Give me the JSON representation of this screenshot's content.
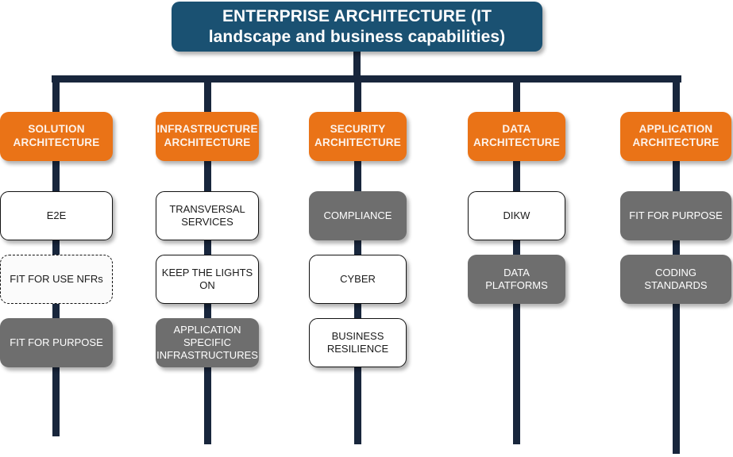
{
  "title": {
    "text": "ENTERPRISE ARCHITECTURE (IT landscape and business capabilities)",
    "color": "#1a5172",
    "text_color": "#ffffff"
  },
  "palette": {
    "orange": "#ea7317",
    "gray": "#6e6e6e",
    "navy_connector": "#18263c",
    "white": "#ffffff",
    "background": "#ffffff"
  },
  "pillars": [
    {
      "id": "solution-architecture",
      "header": "SOLUTION ARCHITECTURE",
      "nodes": [
        {
          "label": "E2E",
          "style": "white"
        },
        {
          "label": "FIT FOR USE NFRs",
          "style": "dashed"
        },
        {
          "label": "FIT FOR PURPOSE",
          "style": "gray"
        }
      ]
    },
    {
      "id": "infrastructure-architecture",
      "header": "INFRASTRUCTURE ARCHITECTURE",
      "nodes": [
        {
          "label": "TRANSVERSAL SERVICES",
          "style": "white"
        },
        {
          "label": "KEEP THE LIGHTS ON",
          "style": "white"
        },
        {
          "label": "APPLICATION SPECIFIC INFRASTRUCTURES",
          "style": "gray"
        }
      ]
    },
    {
      "id": "security-architecture",
      "header": "SECURITY ARCHITECTURE",
      "nodes": [
        {
          "label": "COMPLIANCE",
          "style": "gray"
        },
        {
          "label": "CYBER",
          "style": "white"
        },
        {
          "label": "BUSINESS RESILIENCE",
          "style": "white"
        }
      ]
    },
    {
      "id": "data-architecture",
      "header": "DATA ARCHITECTURE",
      "nodes": [
        {
          "label": "DIKW",
          "style": "white"
        },
        {
          "label": "DATA PLATFORMS",
          "style": "gray"
        }
      ]
    },
    {
      "id": "application-architecture",
      "header": "APPLICATION ARCHITECTURE",
      "nodes": [
        {
          "label": "FIT FOR PURPOSE",
          "style": "gray"
        },
        {
          "label": "CODING STANDARDS",
          "style": "gray"
        }
      ]
    }
  ]
}
